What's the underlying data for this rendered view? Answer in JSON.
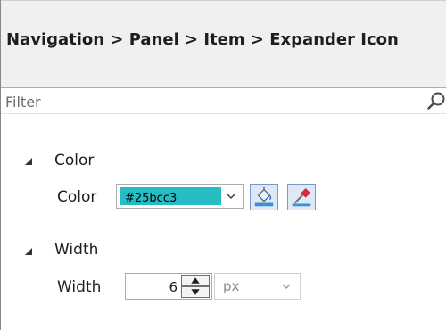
{
  "header": {
    "title": "Navigation > Panel > Item > Expander Icon"
  },
  "filter": {
    "placeholder": "Filter",
    "value": "",
    "icon": "search-icon"
  },
  "categories": [
    {
      "label": "Color",
      "expanded": true,
      "property": {
        "label": "Color",
        "value": "#25bcc3",
        "swatch_color": "#25bcc3",
        "buttons": [
          "paint-bucket-icon",
          "eyedropper-icon"
        ]
      }
    },
    {
      "label": "Width",
      "expanded": true,
      "property": {
        "label": "Width",
        "value": "6",
        "unit": "px"
      }
    }
  ],
  "colors": {
    "header_bg": "#f0f0f0",
    "accent": "#25bcc3",
    "tool_button_bg": "#dfe9f6"
  }
}
